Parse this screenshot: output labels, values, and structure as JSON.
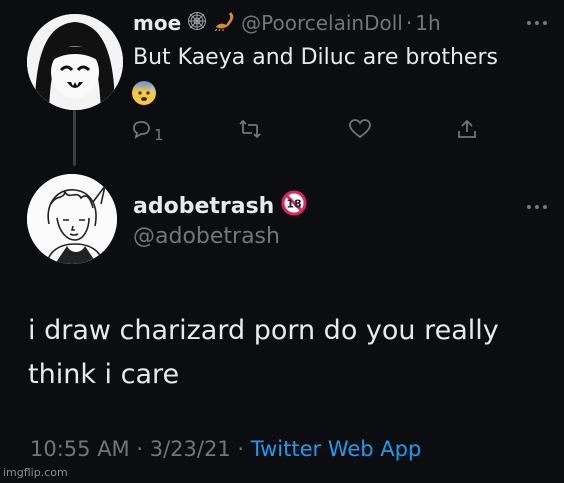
{
  "reply": {
    "name": "moe",
    "handle": "@PoorcelainDoll",
    "separator": "·",
    "time": "1h",
    "text": "But Kaeya and Diluc are brothers",
    "emoji_icon": "anxious-face-emoji",
    "reply_count": "1"
  },
  "tweet": {
    "name": "adobetrash",
    "badge_icon": "no-one-under-18-icon",
    "handle": "@adobetrash",
    "text": "i draw charizard porn do you really think i care",
    "time": "10:55 AM",
    "sep1": "·",
    "date": "3/23/21",
    "sep2": "·",
    "source": "Twitter Web App"
  },
  "watermark": "imgflip.com",
  "colors": {
    "background": "#0c0d10",
    "primary_text": "#e7e9ea",
    "secondary_text": "#71767b",
    "link": "#1d9bf0",
    "badge_red": "#e0245e"
  }
}
